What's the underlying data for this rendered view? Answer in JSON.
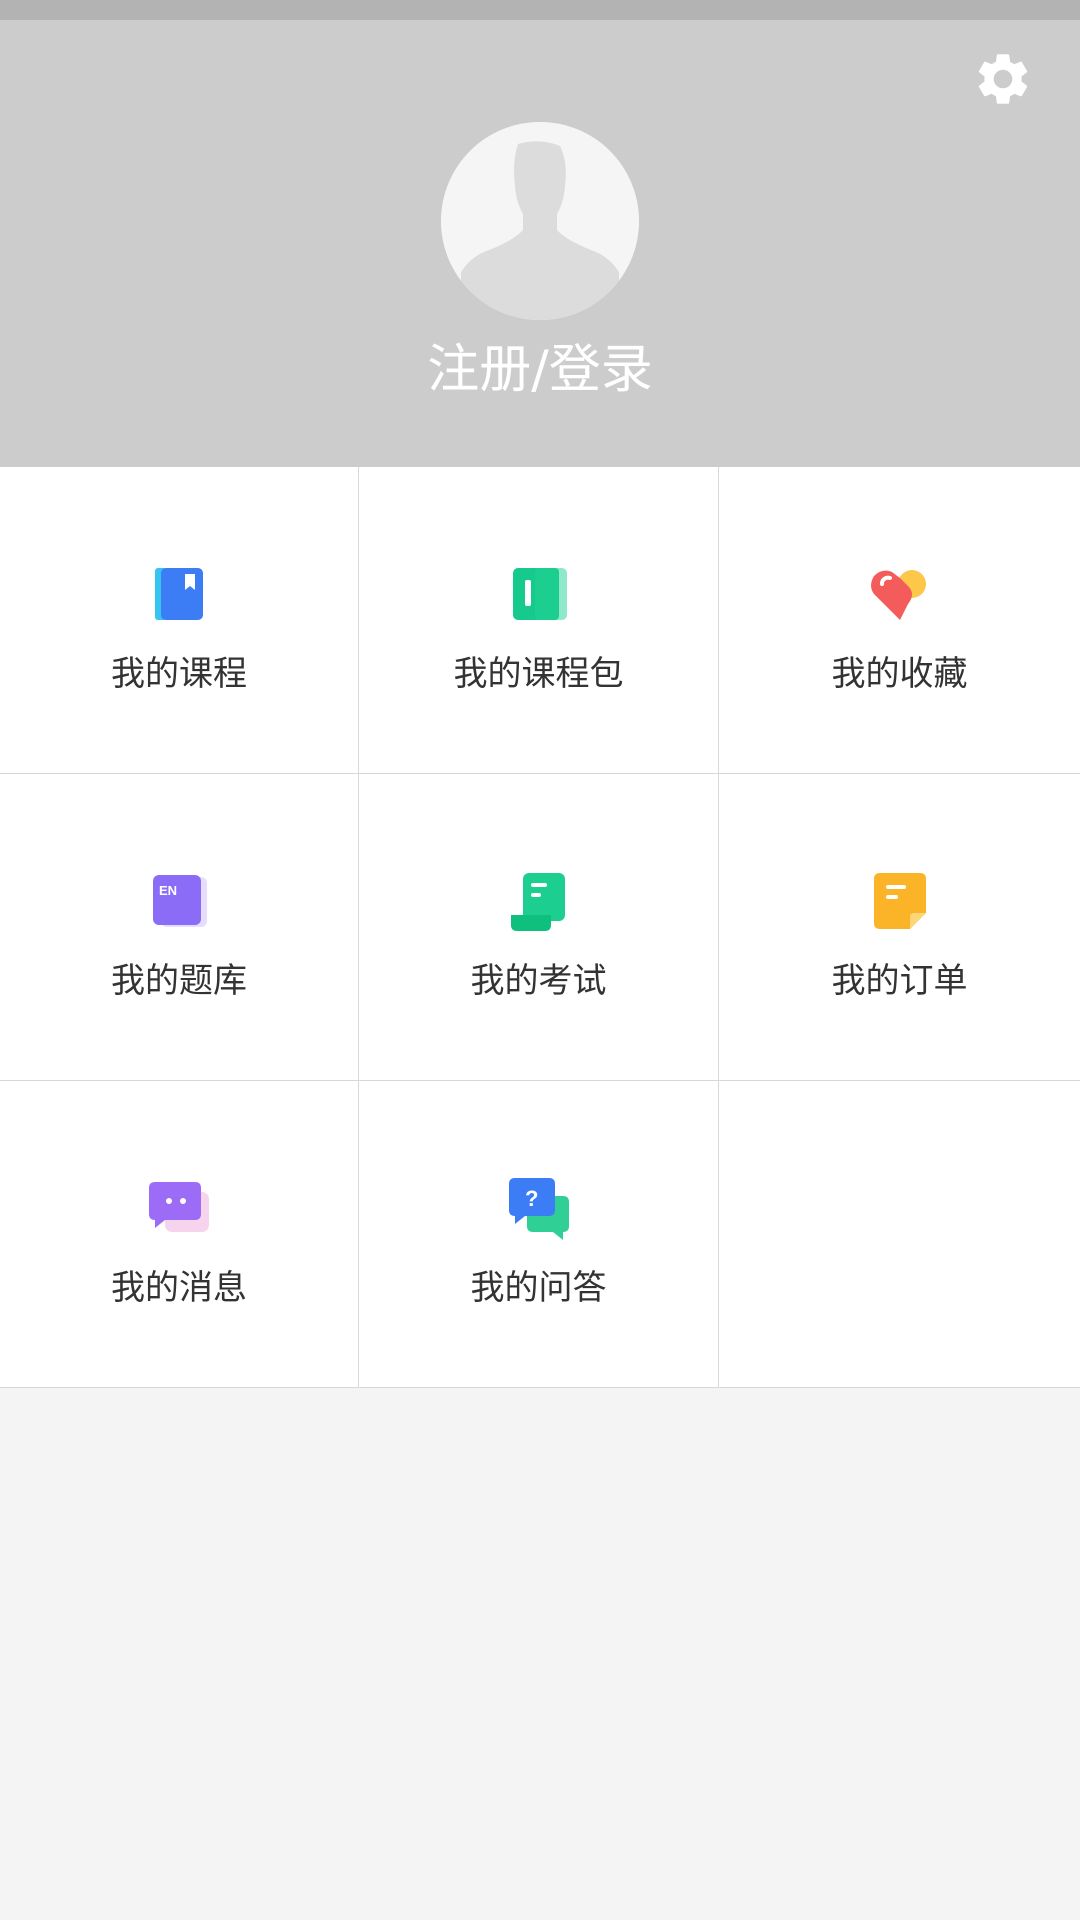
{
  "header": {
    "login_text": "注册/登录",
    "settings_icon": "gear-icon",
    "avatar_icon": "user-avatar-icon"
  },
  "menu": {
    "items": [
      {
        "label": "我的课程",
        "icon": "book-icon",
        "color": "#3c7df5"
      },
      {
        "label": "我的课程包",
        "icon": "open-book-icon",
        "color": "#1ccf91"
      },
      {
        "label": "我的收藏",
        "icon": "heart-tag-icon",
        "color": "#f45b5b"
      },
      {
        "label": "我的题库",
        "icon": "en-book-icon",
        "color": "#8b6cf6"
      },
      {
        "label": "我的考试",
        "icon": "scroll-icon",
        "color": "#1ccf91"
      },
      {
        "label": "我的订单",
        "icon": "note-icon",
        "color": "#fbb327"
      },
      {
        "label": "我的消息",
        "icon": "chat-bubble-icon",
        "color": "#9c6cf6"
      },
      {
        "label": "我的问答",
        "icon": "question-chat-icon",
        "color": "#3c7df5"
      }
    ]
  },
  "colors": {
    "header_bg": "#cccccc",
    "page_bg": "#f4f4f4",
    "text": "#333333"
  }
}
